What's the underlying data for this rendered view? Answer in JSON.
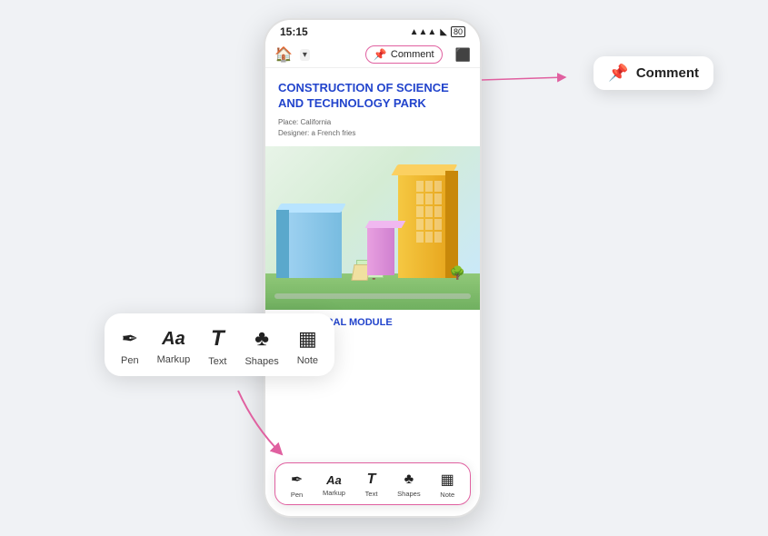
{
  "status_bar": {
    "time": "15:15",
    "signal_icon": "▲▲▲",
    "wifi_icon": "wifi",
    "battery": "80"
  },
  "nav_bar": {
    "home_icon": "🏠",
    "chevron": "▾",
    "comment_label": "Comment",
    "comment_icon": "📌",
    "export_icon": "⬆"
  },
  "document": {
    "title_line1": "CONSTRUCTION OF SCIENCE",
    "title_line2": "AND TECHNOLOGY PARK",
    "meta_place": "Place: California",
    "meta_designer": "Designer: a French fries",
    "section_label": "STRUCTURAL MODULE"
  },
  "comment_tooltip": {
    "icon": "📌",
    "label": "Comment"
  },
  "floating_toolbar": {
    "items": [
      {
        "icon": "✒",
        "label": "Pen"
      },
      {
        "icon": "Aa",
        "label": "Markup"
      },
      {
        "icon": "𝒯",
        "label": "Text"
      },
      {
        "icon": "♣",
        "label": "Shapes"
      },
      {
        "icon": "▦",
        "label": "Note"
      }
    ]
  },
  "phone_toolbar": {
    "items": [
      {
        "icon": "✒",
        "label": "Pen"
      },
      {
        "icon": "Aa",
        "label": "Markup"
      },
      {
        "icon": "𝒯",
        "label": "Text"
      },
      {
        "icon": "♣",
        "label": "Shapes"
      },
      {
        "icon": "▦",
        "label": "Note"
      }
    ]
  }
}
